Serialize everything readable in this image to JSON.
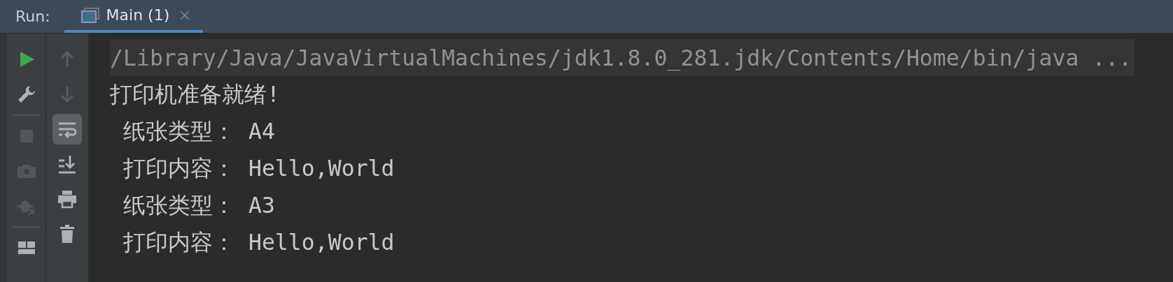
{
  "run_label": "Run:",
  "tabs": [
    {
      "label": "Main (1)",
      "selected": true
    }
  ],
  "toolbar_left": [
    {
      "kind": "run",
      "disabled": false
    },
    {
      "kind": "wrench",
      "disabled": false
    },
    {
      "kind": "separator"
    },
    {
      "kind": "stop",
      "disabled": true
    },
    {
      "kind": "camera",
      "disabled": true
    },
    {
      "kind": "bug",
      "disabled": true
    },
    {
      "kind": "separator"
    },
    {
      "kind": "layout",
      "disabled": false
    }
  ],
  "toolbar_right": [
    {
      "kind": "up",
      "disabled": true,
      "selected": false
    },
    {
      "kind": "down",
      "disabled": true,
      "selected": false
    },
    {
      "kind": "wrap",
      "disabled": false,
      "selected": true
    },
    {
      "kind": "scroll-end",
      "disabled": false,
      "selected": false
    },
    {
      "kind": "print",
      "disabled": false,
      "selected": false
    },
    {
      "kind": "trash",
      "disabled": false,
      "selected": false
    }
  ],
  "console": [
    {
      "kind": "command",
      "text": "/Library/Java/JavaVirtualMachines/jdk1.8.0_281.jdk/Contents/Home/bin/java ..."
    },
    {
      "kind": "output",
      "text": "打印机准备就绪!"
    },
    {
      "kind": "output",
      "text": " 纸张类型： A4"
    },
    {
      "kind": "output",
      "text": " 打印内容： Hello,World"
    },
    {
      "kind": "output",
      "text": " 纸张类型： A3"
    },
    {
      "kind": "output",
      "text": " 打印内容： Hello,World"
    }
  ]
}
